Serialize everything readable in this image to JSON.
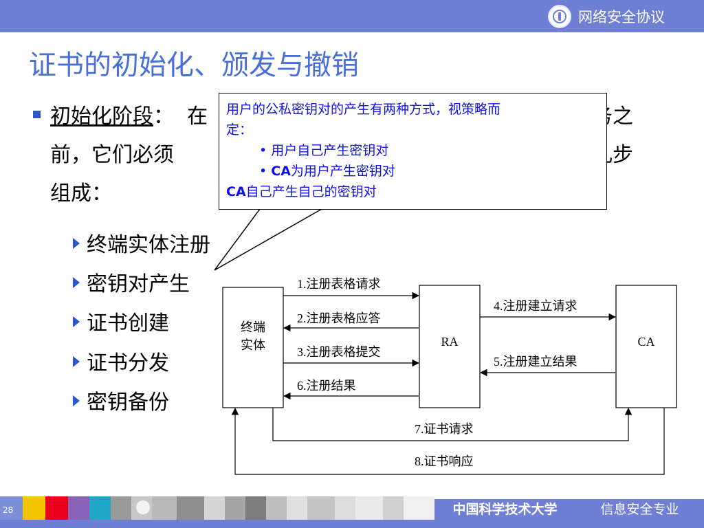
{
  "header": {
    "course_title": "网络安全协议",
    "logo_icon": "university-seal-icon"
  },
  "slide": {
    "title": "证书的初始化、颁发与撤销",
    "bullet": {
      "term": "初始化阶段",
      "colon": "：",
      "line1_start": "在",
      "line1_end": "务之",
      "line2_start": "前，它们必须",
      "line2_end": "几步",
      "line3": "组成："
    },
    "steps": [
      "终端实体注册",
      "密钥对产生",
      "证书创建",
      "证书分发",
      "密钥备份"
    ]
  },
  "callout": {
    "line1": "用户的公私密钥对的产生有两种方式，视策略而",
    "line2": "定：",
    "item1": "用户自己产生密钥对",
    "item2_prefix": "CA",
    "item2_rest": "为用户产生密钥对",
    "line5_prefix": "CA",
    "line5_rest": "自己产生自己的密钥对",
    "bullet_char": "•"
  },
  "diagram": {
    "entity_line1": "终端",
    "entity_line2": "实体",
    "ra": "RA",
    "ca": "CA",
    "arrows": [
      "1.注册表格请求",
      "2.注册表格应答",
      "3.注册表格提交",
      "6.注册结果",
      "4.注册建立请求",
      "5.注册建立结果",
      "7.证书请求",
      "8.证书响应"
    ]
  },
  "footer": {
    "page_number": "28",
    "university": "中国科学技术大学",
    "major": "信息安全专业",
    "swatch_colors": [
      "#f2c500",
      "#e8001c",
      "#8a63b8",
      "#20a7c8"
    ]
  }
}
